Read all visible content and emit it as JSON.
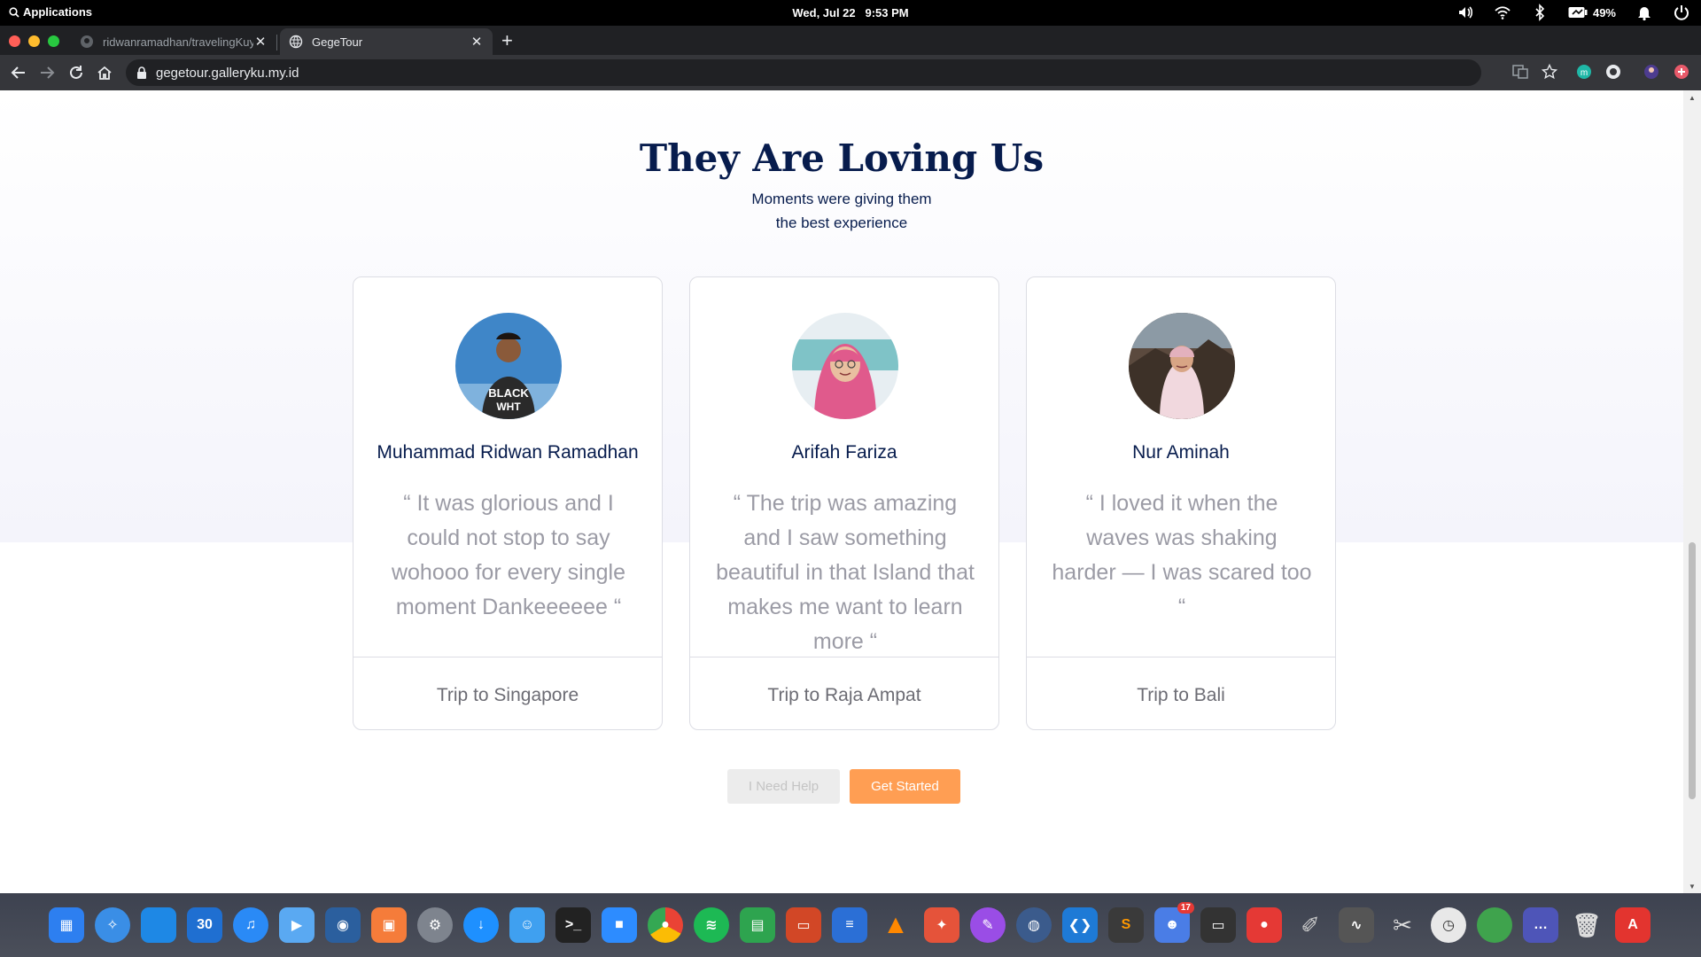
{
  "system_bar": {
    "applications_label": "Applications",
    "date": "Wed, Jul 22",
    "time": "9:53 PM",
    "battery": "49%"
  },
  "browser": {
    "tabs": [
      {
        "title": "ridwanramadhan/travelingKuy",
        "active": false
      },
      {
        "title": "GegeTour",
        "active": true
      }
    ],
    "url": "gegetour.galleryku.my.id"
  },
  "page": {
    "heading": "They Are Loving Us",
    "subheading_line1": "Moments were giving them",
    "subheading_line2": "the best experience",
    "testimonials": [
      {
        "name": "Muhammad Ridwan Ramadhan",
        "quote": "“ It was glorious and I could not stop to say wohooo for every single moment Dankeeeeee “",
        "trip": "Trip to Singapore"
      },
      {
        "name": "Arifah Fariza",
        "quote": "“ The trip was amazing and I saw something beautiful in that Island that makes me want to learn more “",
        "trip": "Trip to Raja Ampat"
      },
      {
        "name": "Nur Aminah",
        "quote": "“ I loved it when the waves was shaking harder — I was scared too “",
        "trip": "Trip to Bali"
      }
    ],
    "buttons": {
      "help": "I Need Help",
      "start": "Get Started"
    }
  },
  "dock": {
    "calendar_day": "30",
    "notification_count": "17",
    "apps": [
      "launchpad-icon",
      "safari-icon",
      "notes-icon",
      "calendar-icon",
      "music-icon",
      "video-icon",
      "camera-icon",
      "photos-icon",
      "settings-icon",
      "downloads-icon",
      "finder-icon",
      "terminal-icon",
      "zoom-icon",
      "chrome-icon",
      "spotify-icon",
      "spreadsheet-icon",
      "presentation-icon",
      "document-icon",
      "vlc-icon",
      "gitkraken-icon",
      "paint-icon",
      "globe-icon",
      "vscode-icon",
      "sublime-icon",
      "discord-icon",
      "monitor-icon",
      "recorder-icon",
      "brush-icon",
      "activity-icon",
      "scissors-icon",
      "clock-icon",
      "green-app-icon",
      "screen-icon",
      "trash-icon",
      "pdf-icon"
    ]
  },
  "colors": {
    "heading": "#071c4d",
    "accent": "#ff9e53",
    "muted_text": "#9b9ba5"
  }
}
